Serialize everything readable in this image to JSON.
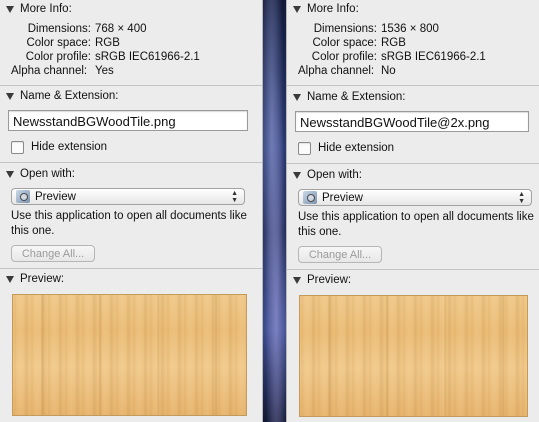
{
  "left": {
    "more_info": {
      "title": "More Info:",
      "rows": [
        {
          "label": "Dimensions:",
          "value": "768 × 400"
        },
        {
          "label": "Color space:",
          "value": "RGB"
        },
        {
          "label": "Color profile:",
          "value": "sRGB IEC61966-2.1"
        },
        {
          "label": "Alpha channel:",
          "value": "Yes"
        }
      ]
    },
    "name_ext": {
      "title": "Name & Extension:",
      "filename": "NewsstandBGWoodTile.png",
      "hide_extension_label": "Hide extension"
    },
    "open_with": {
      "title": "Open with:",
      "app": "Preview",
      "description": "Use this application to open all documents like this one.",
      "change_all_label": "Change All..."
    },
    "preview": {
      "title": "Preview:"
    }
  },
  "right": {
    "more_info": {
      "title": "More Info:",
      "rows": [
        {
          "label": "Dimensions:",
          "value": "1536 × 800"
        },
        {
          "label": "Color space:",
          "value": "RGB"
        },
        {
          "label": "Color profile:",
          "value": "sRGB IEC61966-2.1"
        },
        {
          "label": "Alpha channel:",
          "value": "No"
        }
      ]
    },
    "name_ext": {
      "title": "Name & Extension:",
      "filename": "NewsstandBGWoodTile@2x.png",
      "hide_extension_label": "Hide extension"
    },
    "open_with": {
      "title": "Open with:",
      "app": "Preview",
      "description": "Use this application to open all documents like this one.",
      "change_all_label": "Change All..."
    },
    "preview": {
      "title": "Preview:"
    }
  },
  "icons": [
    "disclosure-triangle-icon",
    "preview-app-icon",
    "popup-arrows-icon"
  ],
  "colors": {
    "panel": "#ececec",
    "wood": "#ebbd77"
  }
}
